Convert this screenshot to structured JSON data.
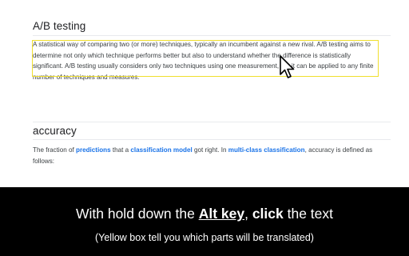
{
  "glossary": {
    "term1": {
      "title": "A/B testing",
      "definition": "A statistical way of comparing two (or more) techniques, typically an incumbent against a new rival. A/B testing aims to determine not only which technique performs better but also to understand whether the difference is statistically significant. A/B testing usually considers only two techniques using one measurement, but it can be applied to any finite number of techniques and measures."
    },
    "term2": {
      "title": "accuracy",
      "def_part1": "The fraction of ",
      "link1": "predictions",
      "def_part2": " that a ",
      "link2": "classification model",
      "def_part3": " got right. In ",
      "link3": "multi-class classification",
      "def_part4": ", accuracy is defined as follows:"
    },
    "highlight_color": "#f0df2e",
    "link_color": "#1a73e8"
  },
  "banner": {
    "line1_part1": "With hold down the ",
    "line1_key": "Alt key",
    "line1_part2": ", ",
    "line1_click": "click",
    "line1_part3": " the text",
    "line2": "(Yellow box tell you which parts will be translated)"
  }
}
